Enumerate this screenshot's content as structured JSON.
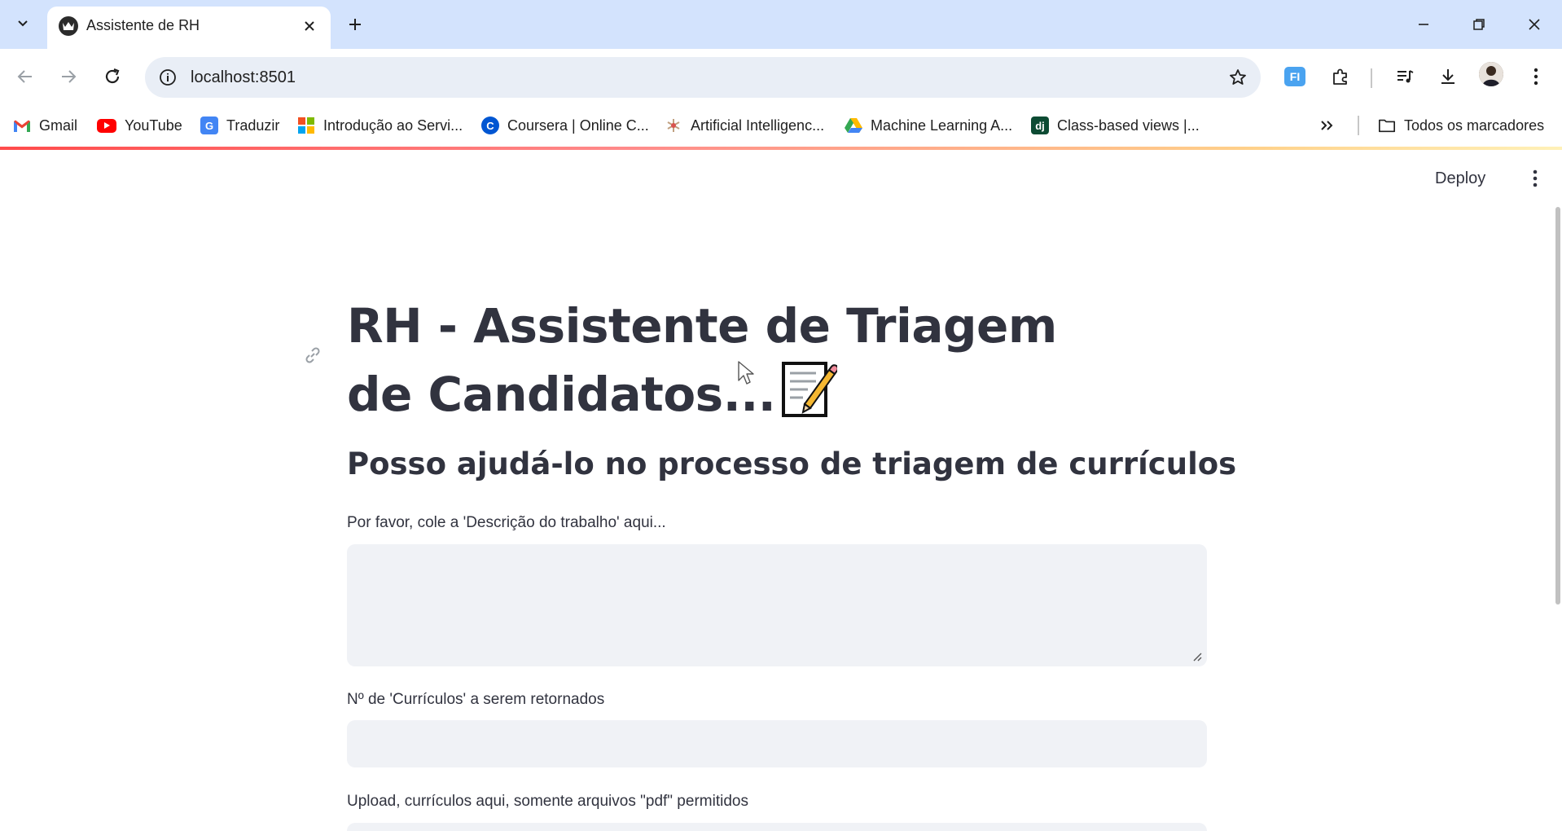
{
  "browser": {
    "tab_title": "Assistente de RH",
    "url": "localhost:8501",
    "bookmarks": [
      {
        "label": "Gmail",
        "icon": "gmail-icon",
        "color": "#EA4335"
      },
      {
        "label": "YouTube",
        "icon": "youtube-icon",
        "color": "#FF0000"
      },
      {
        "label": "Traduzir",
        "icon": "google-translate-icon",
        "color": "#4285F4"
      },
      {
        "label": "Introdução ao Servi...",
        "icon": "microsoft-icon",
        "color": "#F25022"
      },
      {
        "label": "Coursera | Online C...",
        "icon": "coursera-icon",
        "color": "#0056D2"
      },
      {
        "label": "Artificial Intelligenc...",
        "icon": "ai-icon",
        "color": "#C0A080"
      },
      {
        "label": "Machine Learning A...",
        "icon": "google-drive-icon",
        "color": "#34A853"
      },
      {
        "label": "Class-based views |...",
        "icon": "django-icon",
        "color": "#0C4B33"
      }
    ],
    "all_bookmarks": "Todos os marcadores"
  },
  "app": {
    "deploy_label": "Deploy",
    "title": "RH - Assistente de Triagem de Candidatos...",
    "title_emoji": "memo-icon",
    "subtitle": "Posso ajudá-lo no processo de triagem de currículos",
    "job_description_label": "Por favor, cole a 'Descrição do trabalho' aqui...",
    "job_description_value": "",
    "resume_count_label": "Nº de 'Currículos' a serem retornados",
    "resume_count_value": "",
    "upload_label": "Upload, currículos aqui, somente arquivos \"pdf\" permitidos"
  },
  "colors": {
    "accent": "#ff4b4b",
    "text": "#31333f",
    "input_bg": "#f0f2f6",
    "chrome_frame": "#d3e3fd"
  }
}
